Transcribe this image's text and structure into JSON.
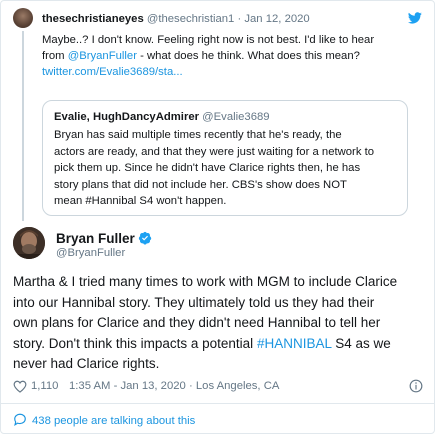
{
  "parent_tweet": {
    "display_name": "thesechristianeyes",
    "handle": "@thesechristian1",
    "separator": "·",
    "date": "Jan 12, 2020",
    "text_line1": "Maybe..? I don't know. Feeling right now is not best. I'd like to hear",
    "text_line2_prefix": "from ",
    "mention": "@BryanFuller",
    "text_line2_suffix": " - what does he think. What does this mean?",
    "link": "twitter.com/Evalie3689/sta..."
  },
  "quoted_tweet": {
    "display_name": "Evalie, HughDancyAdmirer",
    "handle": "@Evalie3689",
    "lines": [
      "Bryan has said multiple times recently that he's ready, the",
      "actors are ready, and that they were just waiting for a network to",
      "pick them up. Since he didn't have Clarice rights then, he has",
      "story plans that did not include her. CBS's show does NOT",
      "mean #Hannibal S4 won't happen."
    ]
  },
  "main_tweet": {
    "display_name": "Bryan Fuller",
    "handle": "@BryanFuller",
    "lines": [
      "Martha & I tried many times to work with MGM to include Clarice",
      "into our Hannibal story. They ultimately told us they had their",
      "own plans for Clarice and they didn't need Hannibal to tell her",
      "story. Don't think this impacts a potential "
    ],
    "hashtag": "#HANNIBAL",
    "line4_suffix": " S4 as we",
    "line5": "never had Clarice rights.",
    "likes": "1,110",
    "timestamp": "1:35 AM - Jan 13, 2020",
    "location_separator": " · ",
    "location": "Los Angeles, CA"
  },
  "footer": {
    "talking_text": "438 people are talking about this"
  },
  "icons": {
    "bird": "twitter-bird-icon",
    "verified": "verified-badge-icon",
    "heart": "heart-icon",
    "info": "info-icon",
    "bubble": "speech-bubble-icon"
  },
  "colors": {
    "link": "#1b95e0",
    "muted": "#657786",
    "text": "#14171a",
    "border": "#e1e8ed",
    "heart": "#657786"
  }
}
